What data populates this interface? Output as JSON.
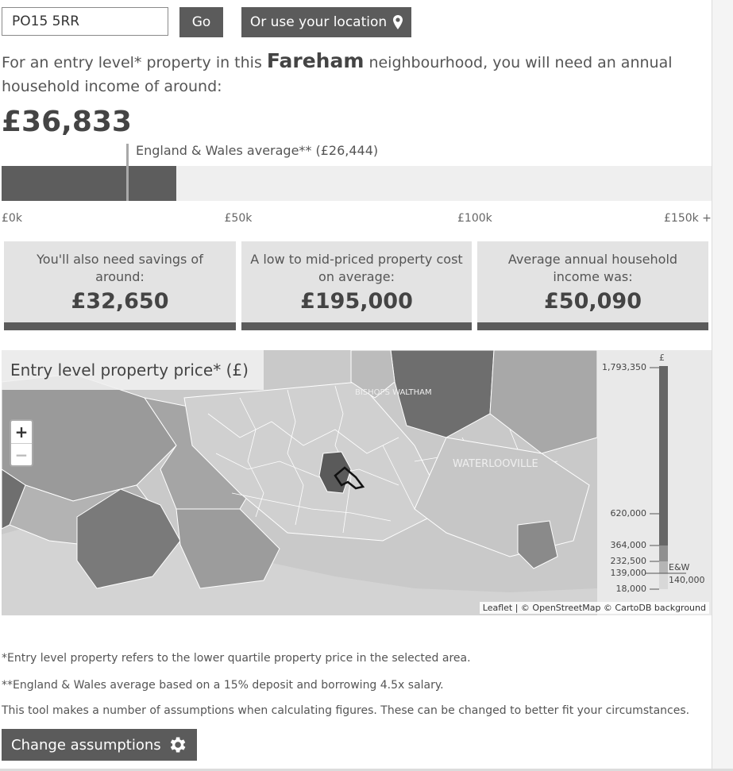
{
  "search": {
    "value": "PO15 5RR",
    "go_label": "Go",
    "location_label": "Or use your location",
    "location_icon": "map-pin-icon"
  },
  "intro": {
    "before": "For an entry level* property in this ",
    "place": "Fareham",
    "after": " neighbourhood, you will need an annual household income of around:"
  },
  "income": {
    "value_text": "£36,833",
    "value": 36833
  },
  "scale": {
    "max": 150000,
    "average_value": 26444,
    "average_label": "England & Wales average** (£26,444)",
    "ticks": [
      {
        "label": "£0k",
        "value": 0
      },
      {
        "label": "£50k",
        "value": 50000
      },
      {
        "label": "£100k",
        "value": 100000
      },
      {
        "label": "£150k +",
        "value": 150000
      }
    ]
  },
  "stats": [
    {
      "label": "You'll also need savings of around:",
      "value": "£32,650"
    },
    {
      "label": "A low to mid-priced property cost on average:",
      "value": "£195,000"
    },
    {
      "label": "Average annual household income was:",
      "value": "£50,090"
    }
  ],
  "map": {
    "title": "Entry level property price* (£)",
    "zoom_in": "+",
    "zoom_out": "−",
    "attribution": "Leaflet | © OpenStreetMap © CartoDB background",
    "legend": {
      "unit": "£",
      "max": 1793350,
      "values": [
        {
          "label": "1,793,350",
          "value": 1793350
        },
        {
          "label": "620,000",
          "value": 620000
        },
        {
          "label": "364,000",
          "value": 364000
        },
        {
          "label": "232,500",
          "value": 232500
        },
        {
          "label": "139,000",
          "value": 139000
        },
        {
          "label": "18,000",
          "value": 18000
        }
      ],
      "ew_label": "E&W",
      "ew_value_label": "140,000",
      "ew_value": 140000
    },
    "place_labels": [
      "WATERLOOVILLE",
      "BISHOPS WALTHAM"
    ]
  },
  "notes": [
    "*Entry level property refers to the lower quartile property price in the selected area.",
    "**England & Wales average based on a 15% deposit and borrowing 4.5x salary.",
    "This tool makes a number of assumptions when calculating figures. These can be changed to better fit your circumstances."
  ],
  "assumptions_button": {
    "label": "Change assumptions",
    "icon": "gear-icon"
  },
  "colors": {
    "button": "#5b5b5b",
    "bar": "#5d5d5d",
    "track": "#efefef",
    "box": "#e3e3e3"
  }
}
